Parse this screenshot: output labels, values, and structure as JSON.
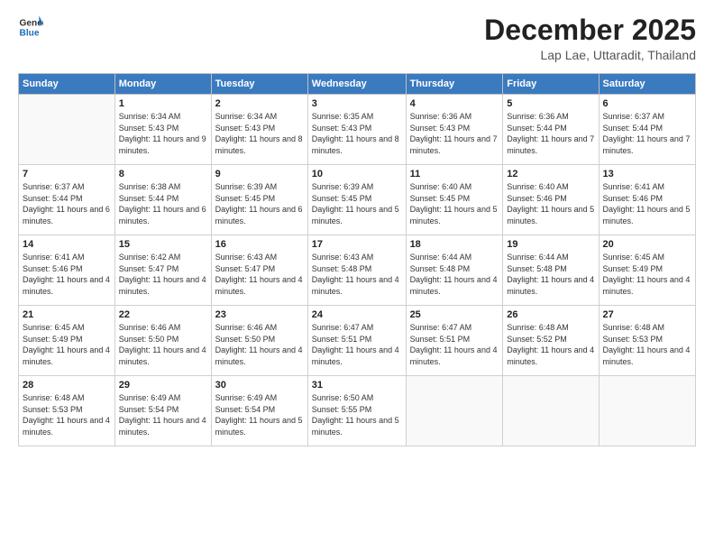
{
  "logo": {
    "line1": "General",
    "line2": "Blue"
  },
  "title": "December 2025",
  "subtitle": "Lap Lae, Uttaradit, Thailand",
  "days_of_week": [
    "Sunday",
    "Monday",
    "Tuesday",
    "Wednesday",
    "Thursday",
    "Friday",
    "Saturday"
  ],
  "weeks": [
    [
      {
        "day": "",
        "sunrise": "",
        "sunset": "",
        "daylight": ""
      },
      {
        "day": "1",
        "sunrise": "Sunrise: 6:34 AM",
        "sunset": "Sunset: 5:43 PM",
        "daylight": "Daylight: 11 hours and 9 minutes."
      },
      {
        "day": "2",
        "sunrise": "Sunrise: 6:34 AM",
        "sunset": "Sunset: 5:43 PM",
        "daylight": "Daylight: 11 hours and 8 minutes."
      },
      {
        "day": "3",
        "sunrise": "Sunrise: 6:35 AM",
        "sunset": "Sunset: 5:43 PM",
        "daylight": "Daylight: 11 hours and 8 minutes."
      },
      {
        "day": "4",
        "sunrise": "Sunrise: 6:36 AM",
        "sunset": "Sunset: 5:43 PM",
        "daylight": "Daylight: 11 hours and 7 minutes."
      },
      {
        "day": "5",
        "sunrise": "Sunrise: 6:36 AM",
        "sunset": "Sunset: 5:44 PM",
        "daylight": "Daylight: 11 hours and 7 minutes."
      },
      {
        "day": "6",
        "sunrise": "Sunrise: 6:37 AM",
        "sunset": "Sunset: 5:44 PM",
        "daylight": "Daylight: 11 hours and 7 minutes."
      }
    ],
    [
      {
        "day": "7",
        "sunrise": "Sunrise: 6:37 AM",
        "sunset": "Sunset: 5:44 PM",
        "daylight": "Daylight: 11 hours and 6 minutes."
      },
      {
        "day": "8",
        "sunrise": "Sunrise: 6:38 AM",
        "sunset": "Sunset: 5:44 PM",
        "daylight": "Daylight: 11 hours and 6 minutes."
      },
      {
        "day": "9",
        "sunrise": "Sunrise: 6:39 AM",
        "sunset": "Sunset: 5:45 PM",
        "daylight": "Daylight: 11 hours and 6 minutes."
      },
      {
        "day": "10",
        "sunrise": "Sunrise: 6:39 AM",
        "sunset": "Sunset: 5:45 PM",
        "daylight": "Daylight: 11 hours and 5 minutes."
      },
      {
        "day": "11",
        "sunrise": "Sunrise: 6:40 AM",
        "sunset": "Sunset: 5:45 PM",
        "daylight": "Daylight: 11 hours and 5 minutes."
      },
      {
        "day": "12",
        "sunrise": "Sunrise: 6:40 AM",
        "sunset": "Sunset: 5:46 PM",
        "daylight": "Daylight: 11 hours and 5 minutes."
      },
      {
        "day": "13",
        "sunrise": "Sunrise: 6:41 AM",
        "sunset": "Sunset: 5:46 PM",
        "daylight": "Daylight: 11 hours and 5 minutes."
      }
    ],
    [
      {
        "day": "14",
        "sunrise": "Sunrise: 6:41 AM",
        "sunset": "Sunset: 5:46 PM",
        "daylight": "Daylight: 11 hours and 4 minutes."
      },
      {
        "day": "15",
        "sunrise": "Sunrise: 6:42 AM",
        "sunset": "Sunset: 5:47 PM",
        "daylight": "Daylight: 11 hours and 4 minutes."
      },
      {
        "day": "16",
        "sunrise": "Sunrise: 6:43 AM",
        "sunset": "Sunset: 5:47 PM",
        "daylight": "Daylight: 11 hours and 4 minutes."
      },
      {
        "day": "17",
        "sunrise": "Sunrise: 6:43 AM",
        "sunset": "Sunset: 5:48 PM",
        "daylight": "Daylight: 11 hours and 4 minutes."
      },
      {
        "day": "18",
        "sunrise": "Sunrise: 6:44 AM",
        "sunset": "Sunset: 5:48 PM",
        "daylight": "Daylight: 11 hours and 4 minutes."
      },
      {
        "day": "19",
        "sunrise": "Sunrise: 6:44 AM",
        "sunset": "Sunset: 5:48 PM",
        "daylight": "Daylight: 11 hours and 4 minutes."
      },
      {
        "day": "20",
        "sunrise": "Sunrise: 6:45 AM",
        "sunset": "Sunset: 5:49 PM",
        "daylight": "Daylight: 11 hours and 4 minutes."
      }
    ],
    [
      {
        "day": "21",
        "sunrise": "Sunrise: 6:45 AM",
        "sunset": "Sunset: 5:49 PM",
        "daylight": "Daylight: 11 hours and 4 minutes."
      },
      {
        "day": "22",
        "sunrise": "Sunrise: 6:46 AM",
        "sunset": "Sunset: 5:50 PM",
        "daylight": "Daylight: 11 hours and 4 minutes."
      },
      {
        "day": "23",
        "sunrise": "Sunrise: 6:46 AM",
        "sunset": "Sunset: 5:50 PM",
        "daylight": "Daylight: 11 hours and 4 minutes."
      },
      {
        "day": "24",
        "sunrise": "Sunrise: 6:47 AM",
        "sunset": "Sunset: 5:51 PM",
        "daylight": "Daylight: 11 hours and 4 minutes."
      },
      {
        "day": "25",
        "sunrise": "Sunrise: 6:47 AM",
        "sunset": "Sunset: 5:51 PM",
        "daylight": "Daylight: 11 hours and 4 minutes."
      },
      {
        "day": "26",
        "sunrise": "Sunrise: 6:48 AM",
        "sunset": "Sunset: 5:52 PM",
        "daylight": "Daylight: 11 hours and 4 minutes."
      },
      {
        "day": "27",
        "sunrise": "Sunrise: 6:48 AM",
        "sunset": "Sunset: 5:53 PM",
        "daylight": "Daylight: 11 hours and 4 minutes."
      }
    ],
    [
      {
        "day": "28",
        "sunrise": "Sunrise: 6:48 AM",
        "sunset": "Sunset: 5:53 PM",
        "daylight": "Daylight: 11 hours and 4 minutes."
      },
      {
        "day": "29",
        "sunrise": "Sunrise: 6:49 AM",
        "sunset": "Sunset: 5:54 PM",
        "daylight": "Daylight: 11 hours and 4 minutes."
      },
      {
        "day": "30",
        "sunrise": "Sunrise: 6:49 AM",
        "sunset": "Sunset: 5:54 PM",
        "daylight": "Daylight: 11 hours and 5 minutes."
      },
      {
        "day": "31",
        "sunrise": "Sunrise: 6:50 AM",
        "sunset": "Sunset: 5:55 PM",
        "daylight": "Daylight: 11 hours and 5 minutes."
      },
      {
        "day": "",
        "sunrise": "",
        "sunset": "",
        "daylight": ""
      },
      {
        "day": "",
        "sunrise": "",
        "sunset": "",
        "daylight": ""
      },
      {
        "day": "",
        "sunrise": "",
        "sunset": "",
        "daylight": ""
      }
    ]
  ]
}
